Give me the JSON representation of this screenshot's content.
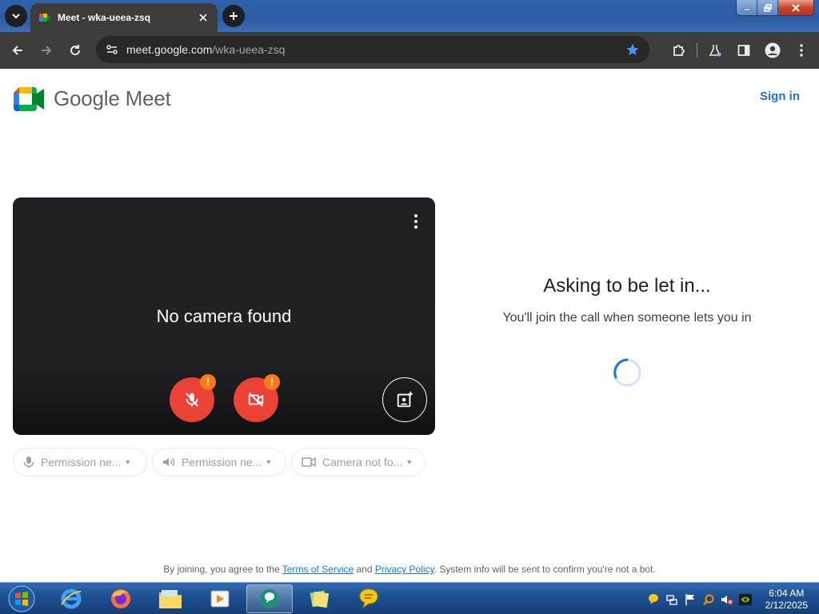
{
  "browser": {
    "tab_title": "Meet - wka-ueea-zsq",
    "url_host": "meet.google.com",
    "url_path": "/wka-ueea-zsq",
    "bookmark_starred": true
  },
  "header": {
    "brand": "Google Meet",
    "signin_label": "Sign in"
  },
  "preview": {
    "status_text": "No camera found",
    "mic_warning": "!",
    "cam_warning": "!"
  },
  "devices": [
    {
      "icon": "mic-icon",
      "label": "Permission ne..."
    },
    {
      "icon": "speaker-icon",
      "label": "Permission ne..."
    },
    {
      "icon": "camera-icon",
      "label": "Camera not fo..."
    }
  ],
  "join": {
    "title": "Asking to be let in...",
    "subtitle": "You'll join the call when someone lets you in"
  },
  "footer": {
    "prefix": "By joining, you agree to the ",
    "terms": "Terms of Service",
    "middle": " and ",
    "privacy": "Privacy Policy",
    "suffix": ". System info will be sent to confirm you're not a bot."
  },
  "taskbar": {
    "time": "6:04 AM",
    "date": "2/12/2025"
  },
  "colors": {
    "brand_blue": "#1a73e8",
    "danger_red": "#ea4335",
    "warning_orange": "#fa7b17"
  }
}
